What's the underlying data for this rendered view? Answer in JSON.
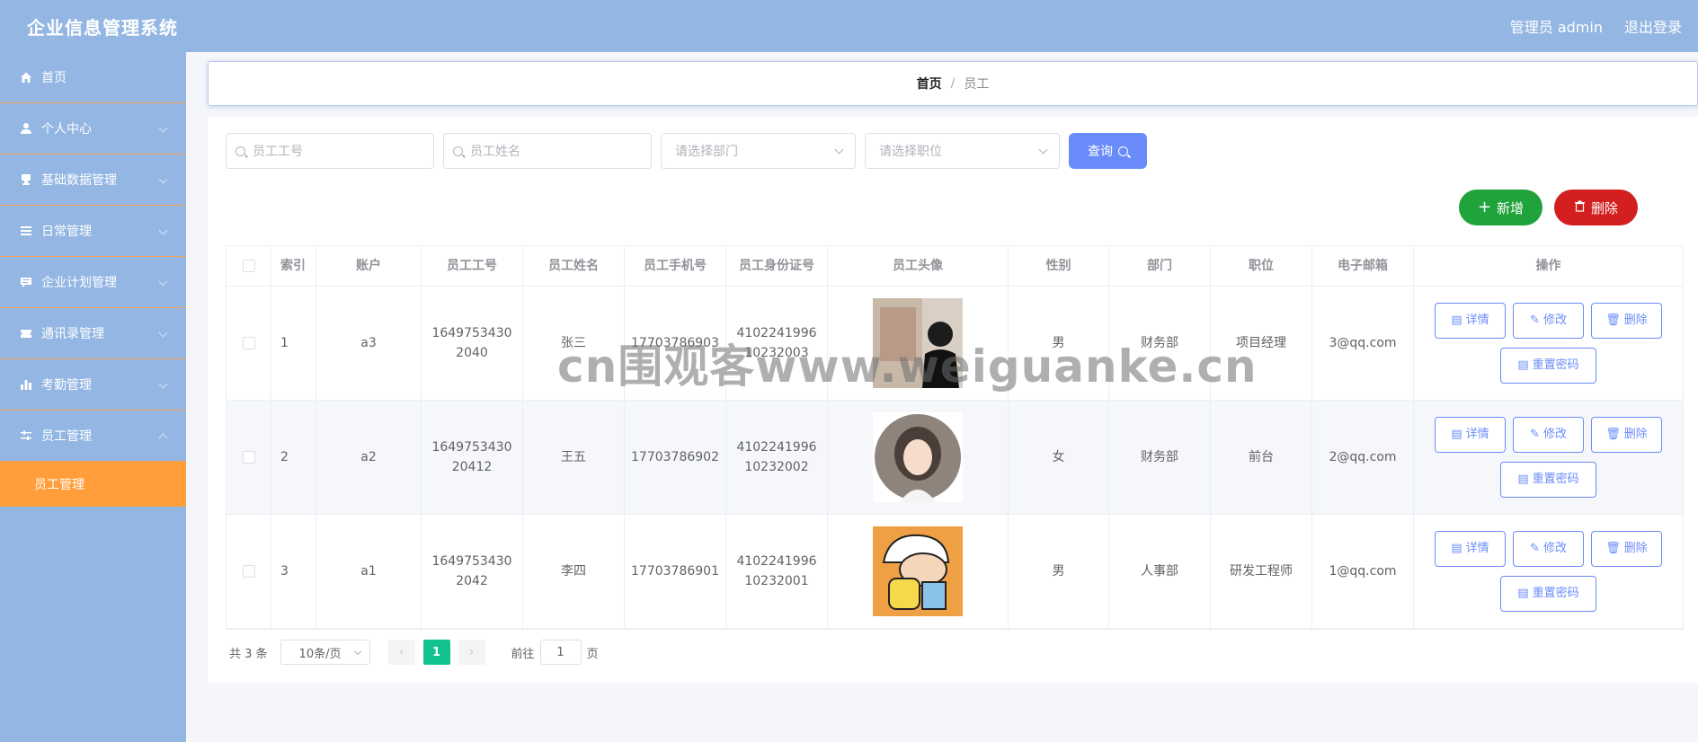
{
  "app": {
    "title": "企业信息管理系统"
  },
  "header": {
    "user_label": "管理员 admin",
    "logout_label": "退出登录"
  },
  "sidebar": {
    "items": [
      {
        "label": "首页",
        "icon": "home-icon"
      },
      {
        "label": "个人中心",
        "icon": "user-icon"
      },
      {
        "label": "基础数据管理",
        "icon": "stamp-icon"
      },
      {
        "label": "日常管理",
        "icon": "list-icon"
      },
      {
        "label": "企业计划管理",
        "icon": "message-icon"
      },
      {
        "label": "通讯录管理",
        "icon": "ticket-icon"
      },
      {
        "label": "考勤管理",
        "icon": "bar-chart-icon"
      },
      {
        "label": "员工管理",
        "icon": "sliders-icon"
      }
    ],
    "active_sub": "员工管理"
  },
  "breadcrumb": {
    "home": "首页",
    "separator": "/",
    "current": "员工"
  },
  "filters": {
    "emp_no_placeholder": "员工工号",
    "emp_name_placeholder": "员工姓名",
    "dept_placeholder": "请选择部门",
    "position_placeholder": "请选择职位",
    "query_label": "查询"
  },
  "actions": {
    "add_label": "新增",
    "delete_label": "删除"
  },
  "table": {
    "headers": [
      "索引",
      "账户",
      "员工工号",
      "员工姓名",
      "员工手机号",
      "员工身份证号",
      "员工头像",
      "性别",
      "部门",
      "职位",
      "电子邮箱",
      "操作"
    ],
    "rows": [
      {
        "index": "1",
        "account": "a3",
        "emp_no": "16497534302040",
        "name": "张三",
        "phone": "17703786903",
        "id_no": "410224199610232003",
        "sex": "男",
        "dept": "财务部",
        "position": "项目经理",
        "email": "3@qq.com"
      },
      {
        "index": "2",
        "account": "a2",
        "emp_no": "164975343020412",
        "name": "王五",
        "phone": "17703786902",
        "id_no": "410224199610232002",
        "sex": "女",
        "dept": "财务部",
        "position": "前台",
        "email": "2@qq.com"
      },
      {
        "index": "3",
        "account": "a1",
        "emp_no": "16497534302042",
        "name": "李四",
        "phone": "17703786901",
        "id_no": "410224199610232001",
        "sex": "男",
        "dept": "人事部",
        "position": "研发工程师",
        "email": "1@qq.com"
      }
    ],
    "ops": {
      "detail": "详情",
      "edit": "修改",
      "delete": "删除",
      "reset": "重置密码"
    }
  },
  "pagination": {
    "total_label": "共 3 条",
    "page_size": "10条/页",
    "current_page": "1",
    "goto_label": "前往",
    "goto_value": "1",
    "page_suffix": "页"
  },
  "watermark": "cn围观客www.weiguanke.cn",
  "colors": {
    "header_bg": "#93b6e3",
    "accent": "#ff9e3a",
    "primary": "#6a8cfb",
    "success": "#1fa33a",
    "danger": "#d31f1f",
    "page_active": "#13c38f"
  }
}
